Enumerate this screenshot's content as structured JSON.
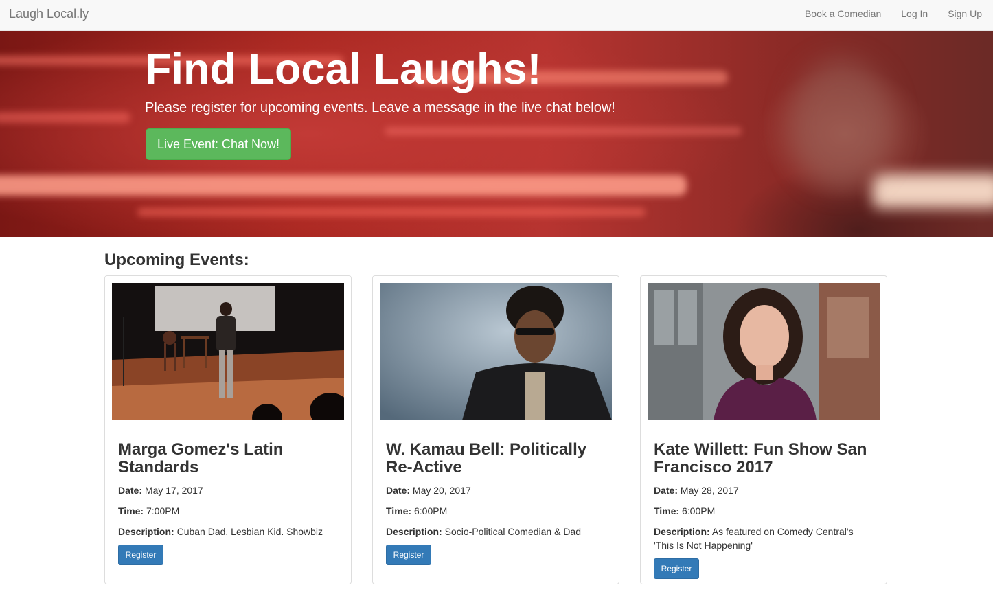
{
  "navbar": {
    "brand": "Laugh Local.ly",
    "links": [
      "Book a Comedian",
      "Log In",
      "Sign Up"
    ]
  },
  "hero": {
    "title": "Find Local Laughs!",
    "subtitle": "Please register for upcoming events. Leave a message in the live chat below!",
    "cta_label": "Live Event: Chat Now!"
  },
  "events_section": {
    "title": "Upcoming Events:",
    "events": [
      {
        "title": "Marga Gomez's Latin Standards",
        "date_label": "Date:",
        "date": "May 17, 2017",
        "time_label": "Time:",
        "time": "7:00PM",
        "description_label": "Description:",
        "description": "Cuban Dad. Lesbian Kid. Showbiz",
        "register_label": "Register"
      },
      {
        "title": "W. Kamau Bell: Politically Re-Active",
        "date_label": "Date:",
        "date": "May 20, 2017",
        "time_label": "Time:",
        "time": "6:00PM",
        "description_label": "Description:",
        "description": "Socio-Political Comedian & Dad",
        "register_label": "Register"
      },
      {
        "title": "Kate Willett: Fun Show San Francisco 2017",
        "date_label": "Date:",
        "date": "May 28, 2017",
        "time_label": "Time:",
        "time": "6:00PM",
        "description_label": "Description:",
        "description": "As featured on Comedy Central's 'This Is Not Happening'",
        "register_label": "Register"
      }
    ]
  },
  "colors": {
    "navbar_bg": "#f8f8f8",
    "cta_green": "#5cb85c",
    "register_blue": "#337ab7"
  }
}
